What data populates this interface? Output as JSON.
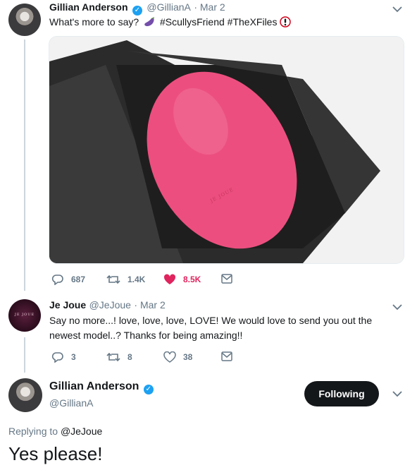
{
  "tweet1": {
    "name": "Gillian Anderson",
    "handle": "@GillianA",
    "date": "· Mar 2",
    "text_before": "What's more to say?",
    "text_after": "#ScullysFriend #TheXFiles",
    "replies": "687",
    "retweets": "1.4K",
    "likes": "8.5K",
    "media_brand": "JE JOUE"
  },
  "tweet2": {
    "name": "Je Joue",
    "handle": "@JeJoue",
    "date": "· Mar 2",
    "text": "Say no more...! love, love, love, LOVE! We would love to send you out the newest model..? Thanks for being amazing!!",
    "avatar_text": "JE JOUE",
    "replies": "3",
    "retweets": "8",
    "likes": "38"
  },
  "tweet3": {
    "name": "Gillian Anderson",
    "handle": "@GillianA",
    "follow_label": "Following",
    "replying_prefix": "Replying to",
    "replying_to": "@JeJoue",
    "text": "Yes please!"
  },
  "colors": {
    "accent": "#1da1f2",
    "like": "#e0245e",
    "egg": "#ec4f7f"
  }
}
